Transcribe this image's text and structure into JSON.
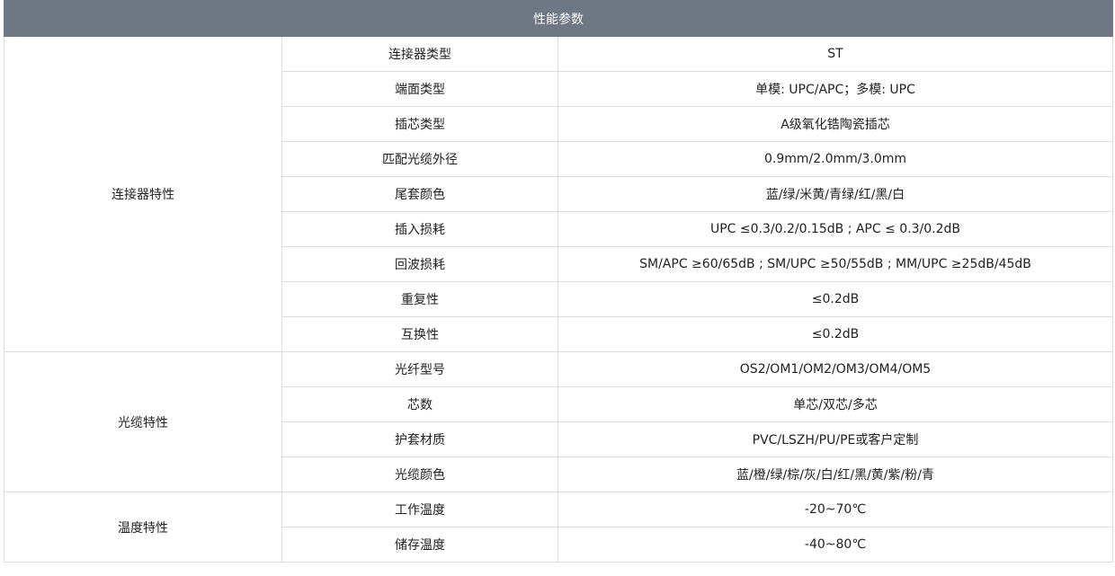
{
  "header": {
    "title": "性能参数"
  },
  "groups": [
    {
      "name": "连接器特性",
      "rows": [
        {
          "param": "连接器类型",
          "value": "ST"
        },
        {
          "param": "端面类型",
          "value": "单模: UPC/APC；多模: UPC"
        },
        {
          "param": "插芯类型",
          "value": "A级氧化锆陶瓷插芯"
        },
        {
          "param": "匹配光缆外径",
          "value": "0.9mm/2.0mm/3.0mm"
        },
        {
          "param": "尾套颜色",
          "value": "蓝/绿/米黄/青绿/红/黑/白"
        },
        {
          "param": "插入损耗",
          "value": "UPC ≤0.3/0.2/0.15dB ; APC ≤  0.3/0.2dB"
        },
        {
          "param": "回波损耗",
          "value": "SM/APC ≥60/65dB ; SM/UPC ≥50/55dB ; MM/UPC ≥25dB/45dB"
        },
        {
          "param": "重复性",
          "value": "≤0.2dB"
        },
        {
          "param": "互换性",
          "value": "≤0.2dB"
        }
      ]
    },
    {
      "name": "光缆特性",
      "rows": [
        {
          "param": "光纤型号",
          "value": "OS2/OM1/OM2/OM3/OM4/OM5"
        },
        {
          "param": "芯数",
          "value": "单芯/双芯/多芯"
        },
        {
          "param": "护套材质",
          "value": "PVC/LSZH/PU/PE或客户定制"
        },
        {
          "param": "光缆颜色",
          "value": "蓝/橙/绿/棕/灰/白/红/黑/黄/紫/粉/青"
        }
      ]
    },
    {
      "name": "温度特性",
      "rows": [
        {
          "param": "工作温度",
          "value": "-20~70℃"
        },
        {
          "param": "储存温度",
          "value": "-40~80℃"
        }
      ]
    }
  ]
}
